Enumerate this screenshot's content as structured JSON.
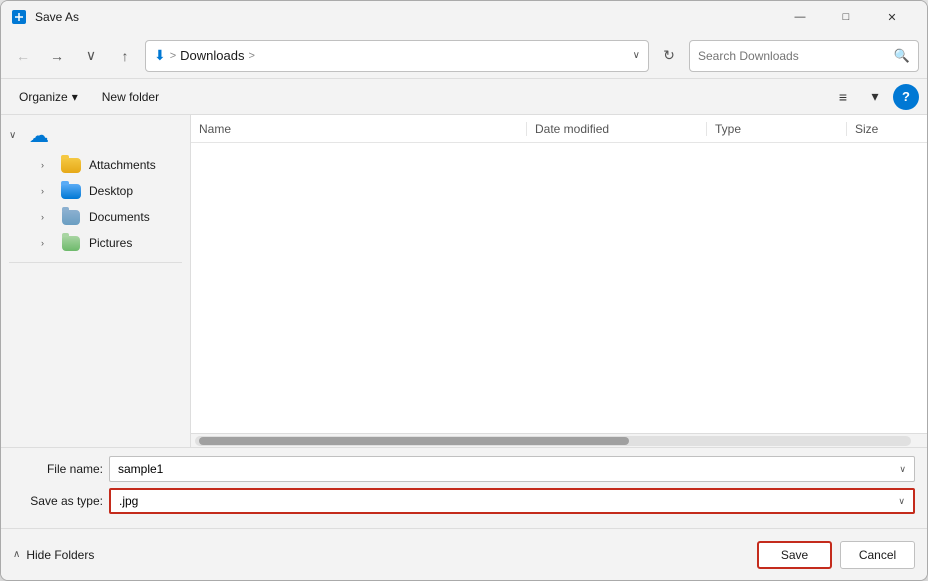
{
  "titleBar": {
    "title": "Save As",
    "controls": {
      "minimize": "—",
      "maximize": "□",
      "close": "✕"
    }
  },
  "toolbar": {
    "backBtn": "←",
    "forwardBtn": "→",
    "dropdownBtn": "∨",
    "upBtn": "↑",
    "downloadIcon": "⬇",
    "separator1": ">",
    "folderName": "Downloads",
    "separator2": ">",
    "expandIcon": "∨",
    "refreshBtn": "↻",
    "searchPlaceholder": "Search Downloads",
    "searchIcon": "🔍"
  },
  "commandBar": {
    "organizeBtn": "Organize",
    "organizeCaret": "▾",
    "newFolderBtn": "New folder",
    "viewIcon": "≡",
    "viewCaret": "▾",
    "helpBtn": "?"
  },
  "sidebar": {
    "chevron": "∨",
    "cloudIcon": "☁",
    "items": [
      {
        "label": "Attachments",
        "iconType": "yellow"
      },
      {
        "label": "Desktop",
        "iconType": "blue"
      },
      {
        "label": "Documents",
        "iconType": "doc"
      },
      {
        "label": "Pictures",
        "iconType": "pic"
      }
    ]
  },
  "fileList": {
    "columns": [
      {
        "label": "Name",
        "key": "name"
      },
      {
        "label": "Date modified",
        "key": "date"
      },
      {
        "label": "Type",
        "key": "type"
      },
      {
        "label": "Size",
        "key": "size"
      }
    ],
    "rows": []
  },
  "bottomFields": {
    "fileNameLabel": "File name:",
    "fileNameValue": "sample1",
    "saveAsTypeLabel": "Save as type:",
    "saveAsTypeValue": ".jpg"
  },
  "actionBar": {
    "hideFoldersArrow": "∧",
    "hideFoldersLabel": "Hide Folders",
    "saveBtn": "Save",
    "cancelBtn": "Cancel"
  }
}
